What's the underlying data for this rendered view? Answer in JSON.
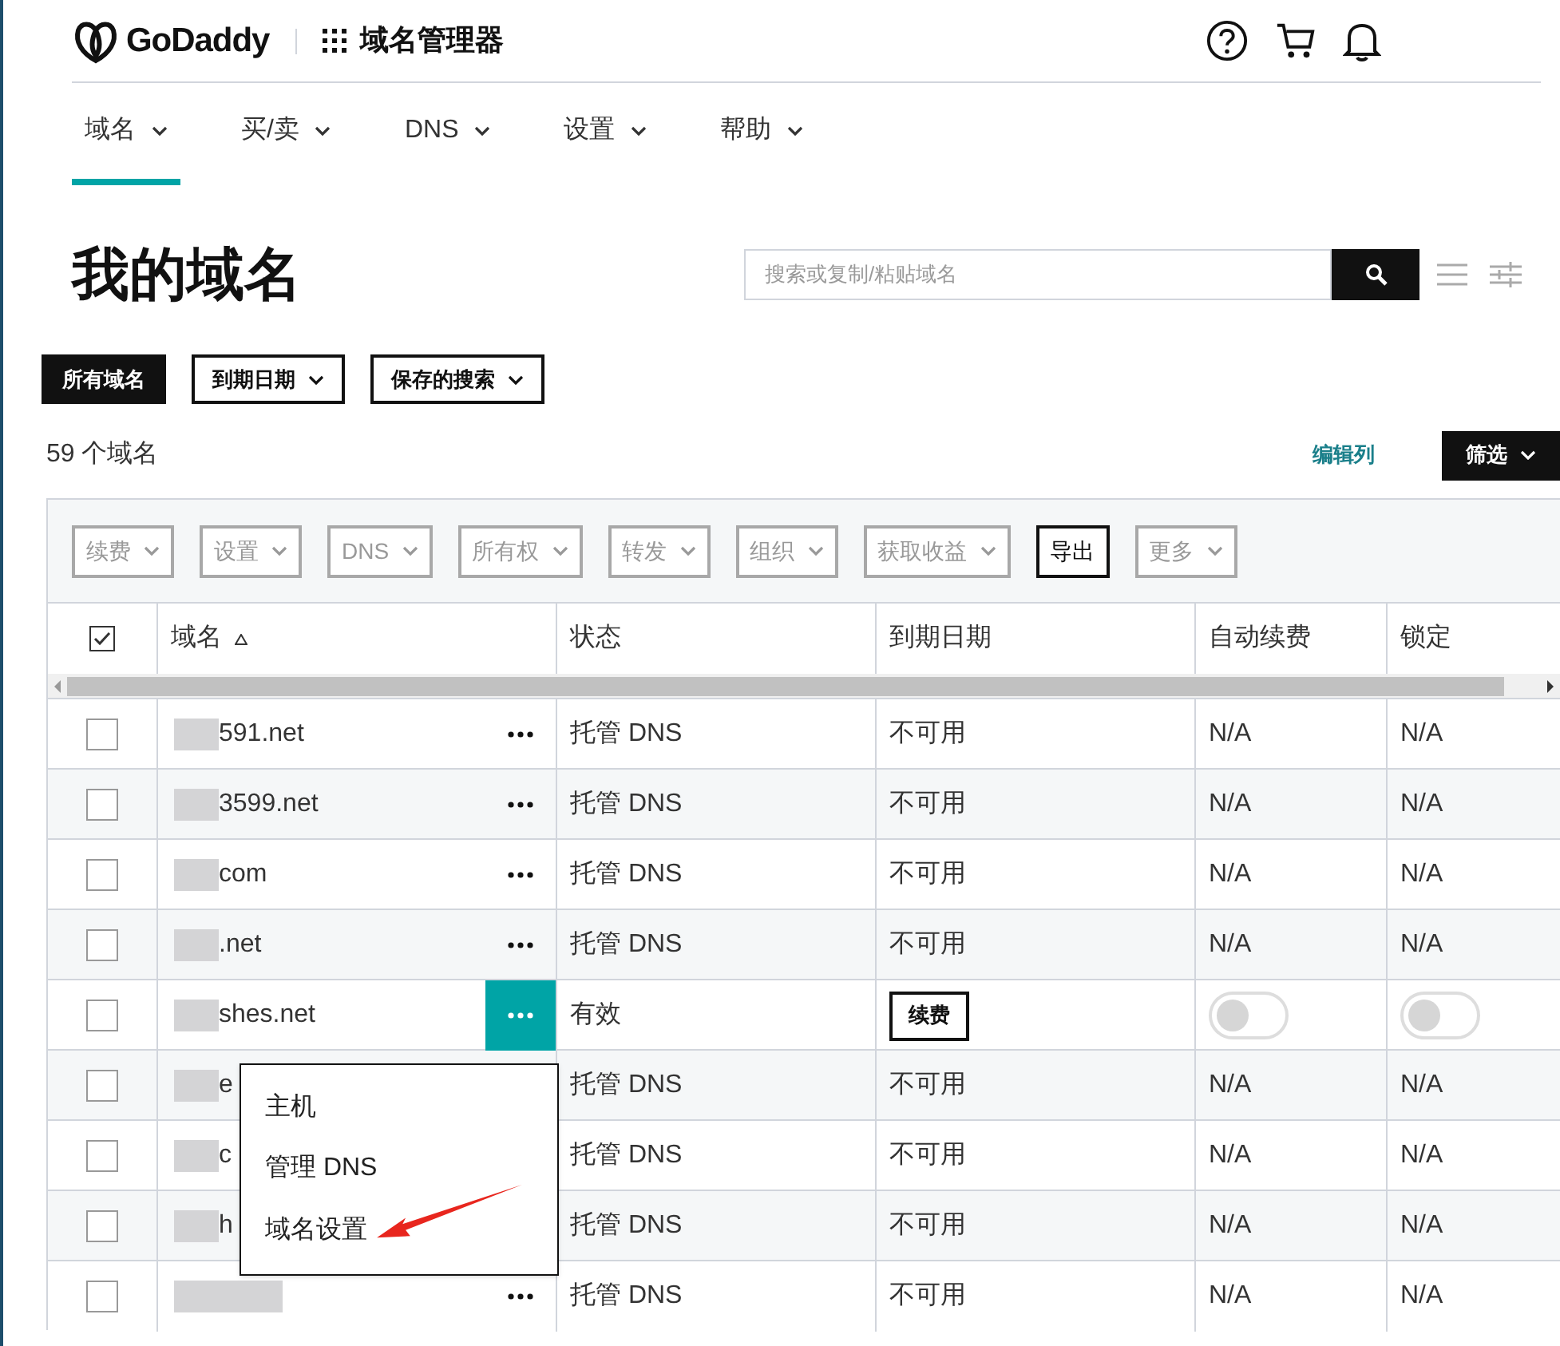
{
  "header": {
    "brand": "GoDaddy",
    "app_title": "域名管理器"
  },
  "nav_tabs": [
    {
      "label": "域名",
      "selected": true
    },
    {
      "label": "买/卖",
      "selected": false
    },
    {
      "label": "DNS",
      "selected": false
    },
    {
      "label": "设置",
      "selected": false
    },
    {
      "label": "帮助",
      "selected": false
    }
  ],
  "page_title": "我的域名",
  "search": {
    "placeholder": "搜索或复制/粘贴域名"
  },
  "filter_buttons": [
    {
      "label": "所有域名",
      "selected": true,
      "dropdown": false
    },
    {
      "label": "到期日期",
      "selected": false,
      "dropdown": true
    },
    {
      "label": "保存的搜索",
      "selected": false,
      "dropdown": true
    }
  ],
  "domain_count": "59 个域名",
  "edit_columns": "编辑列",
  "filter_menu": "筛选",
  "toolbar": [
    {
      "label": "续费",
      "disabled": true,
      "dropdown": true
    },
    {
      "label": "设置",
      "disabled": true,
      "dropdown": true
    },
    {
      "label": "DNS",
      "disabled": true,
      "dropdown": true
    },
    {
      "label": "所有权",
      "disabled": true,
      "dropdown": true
    },
    {
      "label": "转发",
      "disabled": true,
      "dropdown": true
    },
    {
      "label": "组织",
      "disabled": true,
      "dropdown": true
    },
    {
      "label": "获取收益",
      "disabled": true,
      "dropdown": true
    },
    {
      "label": "导出",
      "disabled": false,
      "dropdown": false
    },
    {
      "label": "更多",
      "disabled": true,
      "dropdown": true
    }
  ],
  "table": {
    "select_all": {
      "checked": true
    },
    "columns": [
      "域名",
      "状态",
      "到期日期",
      "自动续费",
      "锁定"
    ],
    "rows": [
      {
        "checked": false,
        "domain": "591.net",
        "more_button": true,
        "status": "托管 DNS",
        "kind": "unavailable",
        "expiry": "不可用",
        "auto_renew": "N/A",
        "lock": "N/A"
      },
      {
        "checked": false,
        "domain": "3599.net",
        "more_button": true,
        "status": "托管 DNS",
        "kind": "unavailable",
        "expiry": "不可用",
        "auto_renew": "N/A",
        "lock": "N/A"
      },
      {
        "checked": false,
        "domain": "com",
        "more_button": true,
        "status": "托管 DNS",
        "kind": "unavailable",
        "expiry": "不可用",
        "auto_renew": "N/A",
        "lock": "N/A"
      },
      {
        "checked": false,
        "domain": ".net",
        "more_button": true,
        "status": "托管 DNS",
        "kind": "unavailable",
        "expiry": "不可用",
        "auto_renew": "N/A",
        "lock": "N/A"
      },
      {
        "checked": false,
        "domain": "shes.net",
        "more_button": true,
        "menu_open": true,
        "status": "有效",
        "kind": "active",
        "renew_button": "续费",
        "auto_renew_on": false,
        "lock_on": false
      },
      {
        "checked": false,
        "domain": "e",
        "more_button": false,
        "status": "托管 DNS",
        "kind": "unavailable",
        "expiry": "不可用",
        "auto_renew": "N/A",
        "lock": "N/A"
      },
      {
        "checked": false,
        "domain": "c",
        "more_button": false,
        "status": "托管 DNS",
        "kind": "unavailable",
        "expiry": "不可用",
        "auto_renew": "N/A",
        "lock": "N/A"
      },
      {
        "checked": false,
        "domain": "h",
        "more_button": false,
        "status": "托管 DNS",
        "kind": "unavailable",
        "expiry": "不可用",
        "auto_renew": "N/A",
        "lock": "N/A"
      },
      {
        "checked": false,
        "more_button": true,
        "status": "托管 DNS",
        "kind": "unavailable",
        "expiry": "不可用",
        "auto_renew": "N/A",
        "lock": "N/A"
      }
    ]
  },
  "row_menu": {
    "items": [
      "主机",
      "管理 DNS",
      "域名设置"
    ]
  }
}
